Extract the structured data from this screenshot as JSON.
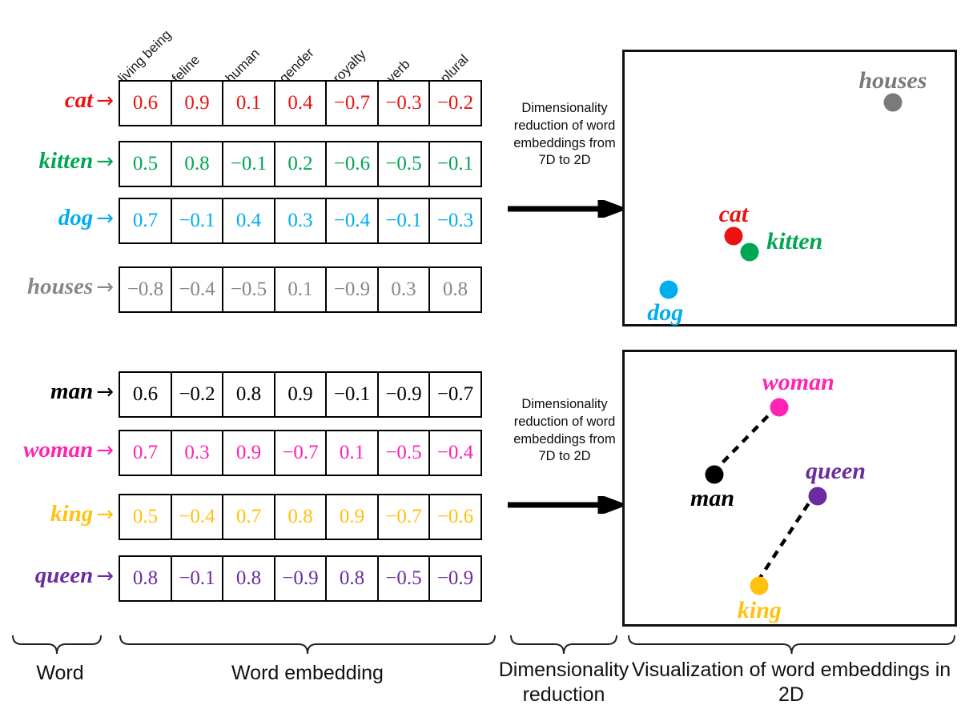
{
  "figure": {
    "dimension_labels": [
      "living being",
      "feline",
      "human",
      "gender",
      "royalty",
      "verb",
      "plural"
    ]
  },
  "tables": [
    {
      "name": "animals-embedding-table",
      "rows": [
        {
          "word": "cat",
          "arrow": "→",
          "color": "#ee1111",
          "values": [
            "0.6",
            "0.9",
            "0.1",
            "0.4",
            "−0.7",
            "−0.3",
            "−0.2"
          ]
        },
        {
          "word": "kitten",
          "arrow": "→",
          "color": "#00a651",
          "values": [
            "0.5",
            "0.8",
            "−0.1",
            "0.2",
            "−0.6",
            "−0.5",
            "−0.1"
          ]
        },
        {
          "word": "dog",
          "arrow": "→",
          "color": "#00adef",
          "values": [
            "0.7",
            "−0.1",
            "0.4",
            "0.3",
            "−0.4",
            "−0.1",
            "−0.3"
          ]
        },
        {
          "word": "houses",
          "arrow": "→",
          "color": "#878787",
          "values": [
            "−0.8",
            "−0.4",
            "−0.5",
            "0.1",
            "−0.9",
            "0.3",
            "0.8"
          ]
        }
      ]
    },
    {
      "name": "people-embedding-table",
      "rows": [
        {
          "word": "man",
          "arrow": "→",
          "color": "#000000",
          "values": [
            "0.6",
            "−0.2",
            "0.8",
            "0.9",
            "−0.1",
            "−0.9",
            "−0.7"
          ]
        },
        {
          "word": "woman",
          "arrow": "→",
          "color": "#ff22b5",
          "values": [
            "0.7",
            "0.3",
            "0.9",
            "−0.7",
            "0.1",
            "−0.5",
            "−0.4"
          ]
        },
        {
          "word": "king",
          "arrow": "→",
          "color": "#ffc20e",
          "values": [
            "0.5",
            "−0.4",
            "0.7",
            "0.8",
            "0.9",
            "−0.7",
            "−0.6"
          ]
        },
        {
          "word": "queen",
          "arrow": "→",
          "color": "#6a2ca0",
          "values": [
            "0.8",
            "−0.1",
            "0.8",
            "−0.9",
            "0.8",
            "−0.5",
            "−0.9"
          ]
        }
      ]
    }
  ],
  "reduction_blocks": [
    {
      "name": "reduction-note-top",
      "text": "Dimensionality reduction of word embeddings from 7D to 2D"
    },
    {
      "name": "reduction-note-bottom",
      "text": "Dimensionality reduction of word embeddings from 7D to 2D"
    }
  ],
  "chart_data": [
    {
      "type": "scatter",
      "name": "animals-2d-projection",
      "title": "",
      "xlabel": "",
      "ylabel": "",
      "xlim": [
        0,
        100
      ],
      "ylim": [
        0,
        100
      ],
      "grid": false,
      "legend": "none",
      "points": [
        {
          "label": "houses",
          "x": 81.0,
          "y": 83.0,
          "color": "#7a7a7a",
          "label_dx": 0,
          "label_dy": -27
        },
        {
          "label": "cat",
          "x": 32.0,
          "y": 33.0,
          "color": "#ee1111",
          "label_dx": 0,
          "label_dy": -27
        },
        {
          "label": "kitten",
          "x": 37.0,
          "y": 27.0,
          "color": "#00a651",
          "label_dx": 56,
          "label_dy": -13
        },
        {
          "label": "dog",
          "x": 12.0,
          "y": 13.0,
          "color": "#00adef",
          "label_dx": -4,
          "label_dy": 29
        }
      ]
    },
    {
      "type": "scatter",
      "name": "gender-royalty-2d-projection",
      "title": "",
      "xlabel": "",
      "ylabel": "",
      "xlim": [
        0,
        100
      ],
      "ylim": [
        0,
        100
      ],
      "grid": false,
      "legend": "none",
      "points": [
        {
          "label": "woman",
          "x": 46.0,
          "y": 81.0,
          "color": "#ff22b5",
          "label_dx": 24,
          "label_dy": -31
        },
        {
          "label": "man",
          "x": 26.0,
          "y": 56.0,
          "color": "#000000",
          "label_dx": -2,
          "label_dy": 30
        },
        {
          "label": "queen",
          "x": 58.0,
          "y": 48.0,
          "color": "#6a2ca0",
          "label_dx": 22,
          "label_dy": -31
        },
        {
          "label": "king",
          "x": 40.0,
          "y": 14.5,
          "color": "#ffc20e",
          "label_dx": 0,
          "label_dy": 31
        }
      ],
      "connections": [
        {
          "from": "man",
          "to": "woman",
          "style": "dashed",
          "color": "#000000"
        },
        {
          "from": "king",
          "to": "queen",
          "style": "dashed",
          "color": "#000000"
        }
      ]
    }
  ],
  "captions": [
    {
      "name": "caption-word",
      "text": "Word"
    },
    {
      "name": "caption-word-embedding",
      "text": "Word embedding"
    },
    {
      "name": "caption-dim-reduction",
      "text": "Dimensionality reduction"
    },
    {
      "name": "caption-visualization",
      "text": "Visualization of word embeddings  in 2D"
    }
  ]
}
